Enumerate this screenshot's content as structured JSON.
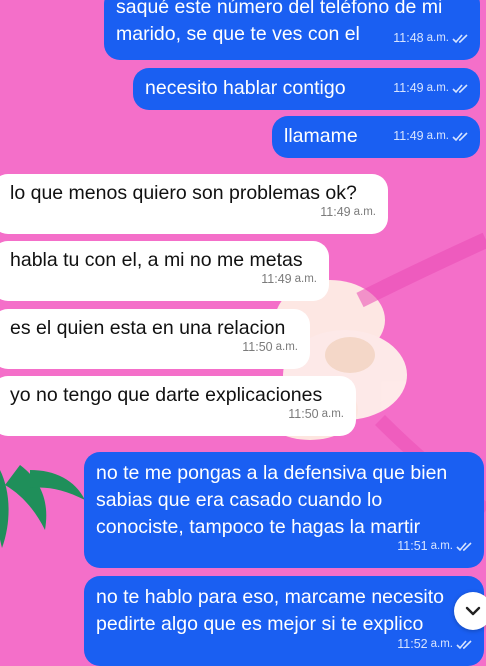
{
  "messages": [
    {
      "direction": "out",
      "text": "saqué este número del teléfono de mi\nmarido, se que te ves con el",
      "time": "11:48",
      "ampm": "a.m.",
      "ticks": "read"
    },
    {
      "direction": "out",
      "text": "necesito hablar contigo",
      "time": "11:49",
      "ampm": "a.m.",
      "ticks": "read"
    },
    {
      "direction": "out",
      "text": "llamame",
      "time": "11:49",
      "ampm": "a.m.",
      "ticks": "read"
    },
    {
      "direction": "in",
      "text": "lo que menos quiero son problemas ok?",
      "time": "11:49",
      "ampm": "a.m."
    },
    {
      "direction": "in",
      "text": "habla tu con el, a mi no me metas",
      "time": "11:49",
      "ampm": "a.m."
    },
    {
      "direction": "in",
      "text": "es el quien esta en una relacion",
      "time": "11:50",
      "ampm": "a.m."
    },
    {
      "direction": "in",
      "text": "yo no tengo que darte explicaciones",
      "time": "11:50",
      "ampm": "a.m."
    },
    {
      "direction": "out",
      "text": "no te me pongas a la defensiva que bien\nsabias que era casado cuando lo\nconociste, tampoco te hagas la martir",
      "time": "11:51",
      "ampm": "a.m.",
      "ticks": "read"
    },
    {
      "direction": "out",
      "text": "no te hablo para eso, marcame necesito\npedirte algo que es mejor si te explico",
      "time": "11:52",
      "ampm": "a.m.",
      "ticks": "read"
    }
  ],
  "colors": {
    "outgoing": "#1a5ff2",
    "incoming": "#ffffff",
    "wallpaper": "#f46fc9"
  },
  "icons": {
    "scroll_down": "chevron-down-icon",
    "read_receipt": "double-check-icon"
  }
}
